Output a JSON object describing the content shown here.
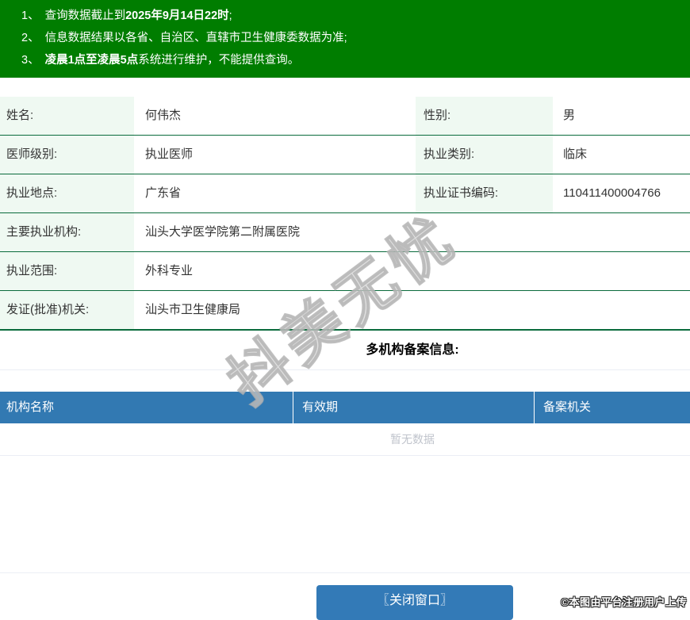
{
  "banner": {
    "bg_color": "#007D00",
    "notices": [
      {
        "num": "1、",
        "t1": "查询数据截止到",
        "b": "2025年9月14日22时",
        "t2": ";"
      },
      {
        "num": "2、",
        "t1": "信息数据结果以各省、自治区、直辖市卫生健康委数据为准;",
        "b": "",
        "t2": ""
      },
      {
        "num": "3、",
        "t1": "",
        "b": "凌晨1点至凌晨5点",
        "t2": "系统进行维护，不能提供查询。"
      }
    ]
  },
  "info": {
    "rows": [
      {
        "label": "姓名:",
        "value": "何伟杰",
        "label2": "性别:",
        "value2": "男"
      },
      {
        "label": "医师级别:",
        "value": "执业医师",
        "label2": "执业类别:",
        "value2": "临床"
      },
      {
        "label": "执业地点:",
        "value": "广东省",
        "label2": "执业证书编码:",
        "value2": "110411400004766"
      },
      {
        "label": "主要执业机构:",
        "value": "汕头大学医学院第二附属医院"
      },
      {
        "label": "执业范围:",
        "value": "外科专业"
      },
      {
        "label": "发证(批准)机关:",
        "value": "汕头市卫生健康局"
      }
    ]
  },
  "section": {
    "title": "多机构备案信息:"
  },
  "records": {
    "header_bg": "#3279B2",
    "headers": [
      "机构名称",
      "有效期",
      "备案机关"
    ],
    "empty_text": "暂无数据"
  },
  "footer": {
    "close_button": "〖关闭窗口〗",
    "attribution": "©本图由平台注册用户上传"
  },
  "watermark": {
    "text": "抖美无忧"
  },
  "colors": {
    "banner_green": "#007D00",
    "row_divider_green": "#0A6B3C",
    "label_bg_mint": "#EFF9F2",
    "table_header_blue": "#3279B2",
    "button_blue": "#337AB7",
    "light_divider": "#EBEEF5",
    "empty_text_gray": "#C0C4CC"
  }
}
